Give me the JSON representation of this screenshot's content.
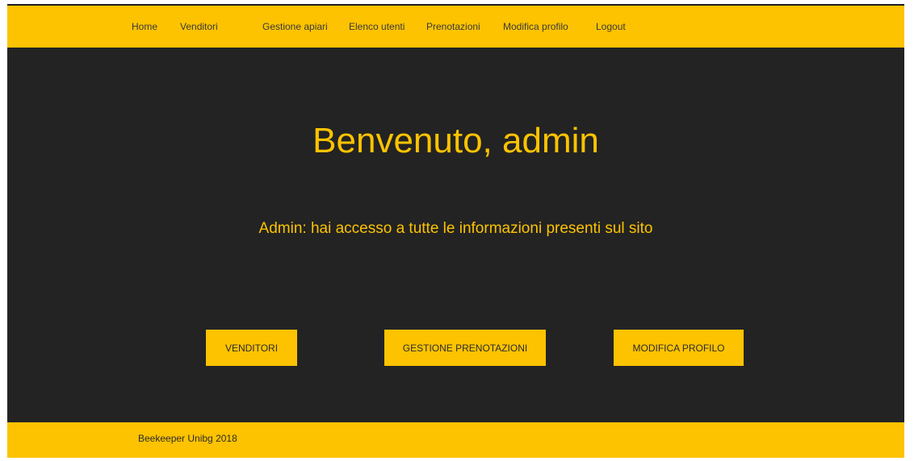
{
  "nav": {
    "home": "Home",
    "vendors": "Venditori",
    "apiaries": "Gestione apiari",
    "users": "Elenco utenti",
    "bookings": "Prenotazioni",
    "edit_profile": "Modifica profilo",
    "logout": "Logout"
  },
  "hero": {
    "title": "Benvenuto, admin",
    "subtitle": "Admin: hai accesso a tutte le informazioni presenti sul sito"
  },
  "actions": {
    "vendors": "VENDITORI",
    "manage_bookings": "GESTIONE PRENOTAZIONI",
    "edit_profile": "MODIFICA PROFILO"
  },
  "footer": {
    "text": "Beekeeper Unibg 2018"
  },
  "colors": {
    "accent": "#fdc300",
    "background": "#232323"
  }
}
